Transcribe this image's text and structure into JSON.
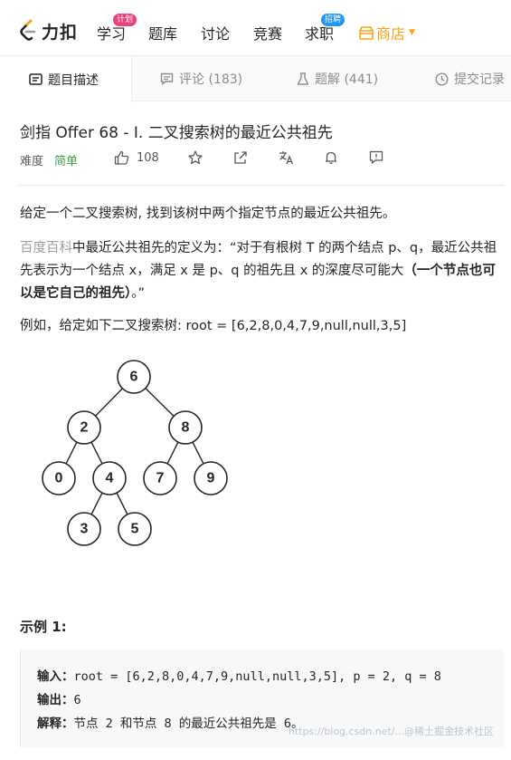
{
  "nav": {
    "logo_text": "力扣",
    "items": [
      {
        "label": "学习",
        "badge": "计划"
      },
      {
        "label": "题库"
      },
      {
        "label": "讨论"
      },
      {
        "label": "竞赛"
      },
      {
        "label": "求职",
        "badge": "招聘"
      }
    ],
    "store_label": "商店"
  },
  "tabs": [
    {
      "label": "题目描述",
      "icon": "description-icon"
    },
    {
      "label": "评论 (183)",
      "icon": "comment-icon"
    },
    {
      "label": "题解 (441)",
      "icon": "flask-icon"
    },
    {
      "label": "提交记录",
      "icon": "clock-icon"
    }
  ],
  "problem": {
    "title": "剑指 Offer 68 - I. 二叉搜索树的最近公共祖先",
    "difficulty_label": "难度",
    "difficulty": "简单",
    "likes": "108"
  },
  "description": {
    "p1": "给定一个二叉搜索树, 找到该树中两个指定节点的最近公共祖先。",
    "link_text": "百度百科",
    "p2_rest": "中最近公共祖先的定义为：“对于有根树 T 的两个结点 p、q，最近公共祖先表示为一个结点 x，满足 x 是 p、q 的祖先且 x 的深度尽可能大",
    "p2_bold": "（一个节点也可以是它自己的祖先）",
    "p2_end": "。”",
    "p3": "例如，给定如下二叉搜索树:  root = [6,2,8,0,4,7,9,null,null,3,5]"
  },
  "tree_nodes": [
    "6",
    "2",
    "8",
    "0",
    "4",
    "7",
    "9",
    "3",
    "5"
  ],
  "example": {
    "title": "示例 1:",
    "input_label": "输入：",
    "input_value": "root = [6,2,8,0,4,7,9,null,null,3,5], p = 2, q = 8",
    "output_label": "输出：",
    "output_value": "6",
    "explain_label": "解释：",
    "explain_value": "节点 2 和节点 8 的最近公共祖先是 6。"
  },
  "watermark": "https://blog.csdn.net/...@稀土掘金技术社区",
  "colors": {
    "accent": "#ffa116",
    "easy": "#43a047",
    "badge_red": "#ec407a",
    "badge_blue": "#2196f3"
  }
}
